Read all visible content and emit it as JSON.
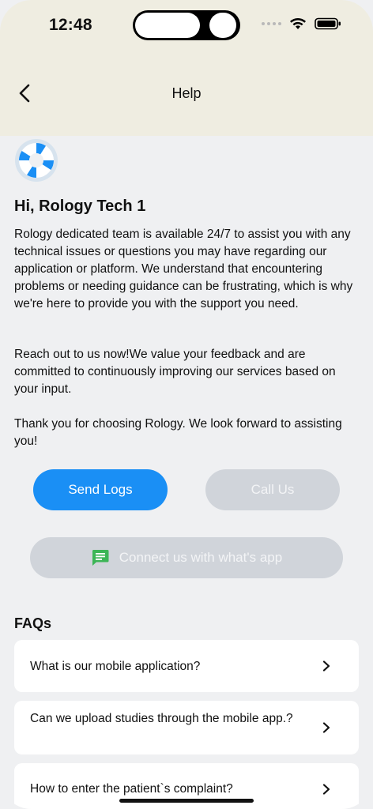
{
  "status_bar": {
    "time": "12:48"
  },
  "header": {
    "title": "Help"
  },
  "greeting": "Hi, Rology Tech 1",
  "paragraphs": [
    "Rology dedicated team is available 24/7 to assist you with any technical issues or questions you may have regarding our application or platform. We understand that encountering problems or needing guidance can be frustrating, which is why we're here to provide you with the support you need.",
    "Reach out to us now!We value your feedback and are committed to continuously improving our services based on your input.",
    "Thank you for choosing Rology. We look forward to assisting you!"
  ],
  "buttons": {
    "send_logs": "Send Logs",
    "call_us": "Call Us",
    "whatsapp": "Connect us with what's app"
  },
  "faqs": {
    "title": "FAQs",
    "items": [
      {
        "question": "What is our mobile application?"
      },
      {
        "question": "Can we upload studies through the mobile app.?"
      },
      {
        "question": "How to enter the patient`s complaint?"
      }
    ]
  },
  "colors": {
    "header_bg": "#efede1",
    "page_bg": "#eff0f2",
    "primary": "#1a8ff5",
    "disabled": "#d0d4da",
    "whatsapp_icon": "#3cb556"
  },
  "icons": {
    "back": "chevron-left-icon",
    "help": "lifebuoy-icon",
    "whatsapp": "chat-message-icon",
    "faq_chevron": "chevron-right-icon"
  }
}
